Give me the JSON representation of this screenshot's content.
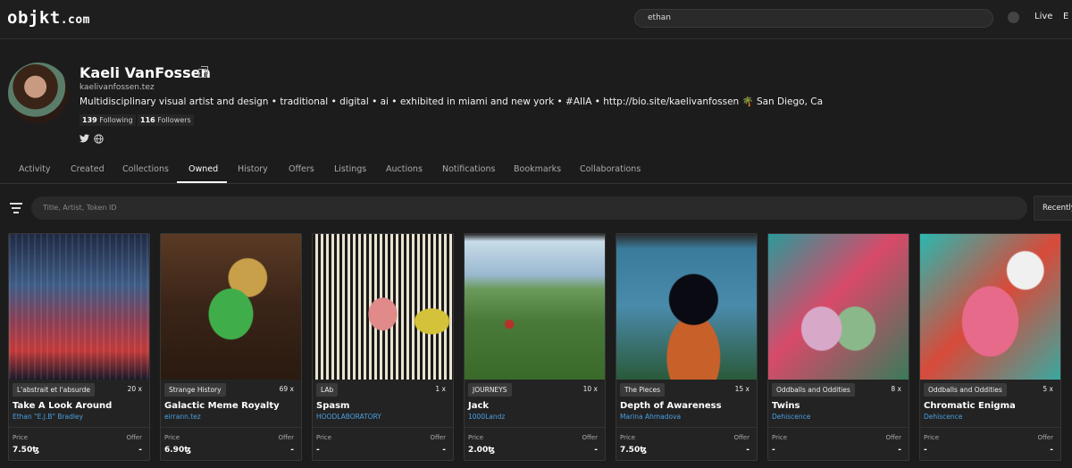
{
  "header": {
    "logo_main": "objkt",
    "logo_suffix": ".com",
    "search_value": "ethan",
    "live_label": "Live",
    "extra_label": "E"
  },
  "profile": {
    "name": "Kaeli VanFossen",
    "tezos_domain": "kaelivanfossen.tez",
    "bio": "Multidisciplinary visual artist and design • traditional • digital • ai • exhibited in miami and new york • #AIIA • http://bio.site/kaelivanfossen 🌴 San Diego, Ca",
    "following_count": "139",
    "following_label": "Following",
    "followers_count": "116",
    "followers_label": "Followers",
    "social_icons": [
      "twitter-icon",
      "globe-icon"
    ]
  },
  "tabs": [
    {
      "label": "Activity"
    },
    {
      "label": "Created"
    },
    {
      "label": "Collections"
    },
    {
      "label": "Owned",
      "active": true
    },
    {
      "label": "History"
    },
    {
      "label": "Offers"
    },
    {
      "label": "Listings"
    },
    {
      "label": "Auctions"
    },
    {
      "label": "Notifications"
    },
    {
      "label": "Bookmarks"
    },
    {
      "label": "Collaborations"
    }
  ],
  "filter": {
    "search_placeholder": "Title, Artist, Token ID",
    "sort_label": "Recently li"
  },
  "cards": [
    {
      "collection": "L'abstrait et l'absurde",
      "editions": "20 x",
      "title": "Take A Look Around",
      "artist": "Ethan \"E.J.B\" Bradley",
      "price_label": "Price",
      "price": "7.50ꜩ",
      "offer_label": "Offer",
      "offer": "-"
    },
    {
      "collection": "Strange History",
      "editions": "69 x",
      "title": "Galactic Meme Royalty",
      "artist": "eirrann.tez",
      "price_label": "Price",
      "price": "6.90ꜩ",
      "offer_label": "Offer",
      "offer": "-"
    },
    {
      "collection": "LAb",
      "editions": "1 x",
      "title": "Spasm",
      "artist": "HOODLABORATORY",
      "price_label": "Price",
      "price": "-",
      "offer_label": "Offer",
      "offer": "-"
    },
    {
      "collection": "JOURNEYS",
      "editions": "10 x",
      "title": "Jack",
      "artist": "1000Landz",
      "price_label": "Price",
      "price": "2.00ꜩ",
      "offer_label": "Offer",
      "offer": "-"
    },
    {
      "collection": "The Pieces",
      "editions": "15 x",
      "title": "Depth of Awareness",
      "artist": "Marina Ahmadova",
      "price_label": "Price",
      "price": "7.50ꜩ",
      "offer_label": "Offer",
      "offer": "-"
    },
    {
      "collection": "Oddballs and Oddities",
      "editions": "8 x",
      "title": "Twins",
      "artist": "Dehiscence",
      "price_label": "Price",
      "price": "-",
      "offer_label": "Offer",
      "offer": "-"
    },
    {
      "collection": "Oddballs and Oddities",
      "editions": "5 x",
      "title": "Chromatic Enigma",
      "artist": "Dehiscence",
      "price_label": "Price",
      "price": "-",
      "offer_label": "Offer",
      "offer": "-"
    }
  ],
  "colors": {
    "background": "#1c1c1c",
    "card": "#232323",
    "artist_link": "#4a9fe0"
  }
}
